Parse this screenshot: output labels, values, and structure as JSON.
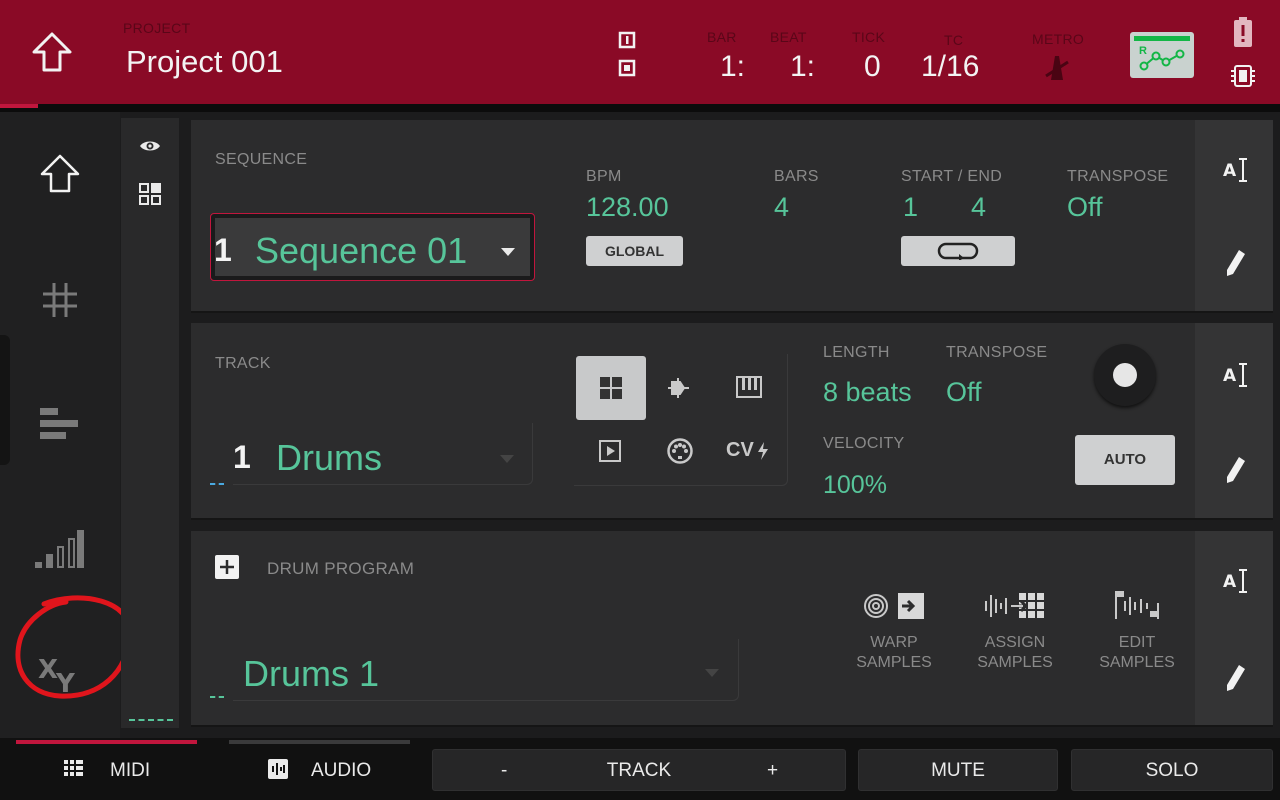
{
  "header": {
    "project_label": "PROJECT",
    "project_name": "Project 001",
    "bar_label": "BAR",
    "bar_value": "1:",
    "beat_label": "BEAT",
    "beat_value": "1:",
    "tick_label": "TICK",
    "tick_value": "0",
    "tc_label": "TC",
    "tc_value": "1/16",
    "metro_label": "METRO",
    "rec_badge": "R"
  },
  "sequence": {
    "section_label": "SEQUENCE",
    "number": "1",
    "name": "Sequence 01",
    "bpm_label": "BPM",
    "bpm_value": "128.00",
    "global_button": "GLOBAL",
    "bars_label": "BARS",
    "bars_value": "4",
    "start_end_label": "START / END",
    "start_value": "1",
    "end_value": "4",
    "transpose_label": "TRANSPOSE",
    "transpose_value": "Off"
  },
  "track": {
    "section_label": "TRACK",
    "number": "1",
    "name": "Drums",
    "length_label": "LENGTH",
    "length_value": "8 beats",
    "transpose_label": "TRANSPOSE",
    "transpose_value": "Off",
    "velocity_label": "VELOCITY",
    "velocity_value": "100%",
    "auto_button": "AUTO",
    "cv_label": "CV"
  },
  "program": {
    "section_label": "DRUM PROGRAM",
    "name": "Drums 1",
    "warp_l1": "WARP",
    "warp_l2": "SAMPLES",
    "assign_l1": "ASSIGN",
    "assign_l2": "SAMPLES",
    "edit_l1": "EDIT",
    "edit_l2": "SAMPLES"
  },
  "side": {
    "a_label": "A"
  },
  "nav": {
    "xy_label": "XY"
  },
  "bottom": {
    "midi": "MIDI",
    "audio": "AUDIO",
    "track_minus": "-",
    "track": "TRACK",
    "track_plus": "+",
    "mute": "MUTE",
    "solo": "SOLO"
  },
  "colors": {
    "header_red": "#8a0a26",
    "accent_green": "#57c59a",
    "annotation_red": "#e0151c"
  }
}
